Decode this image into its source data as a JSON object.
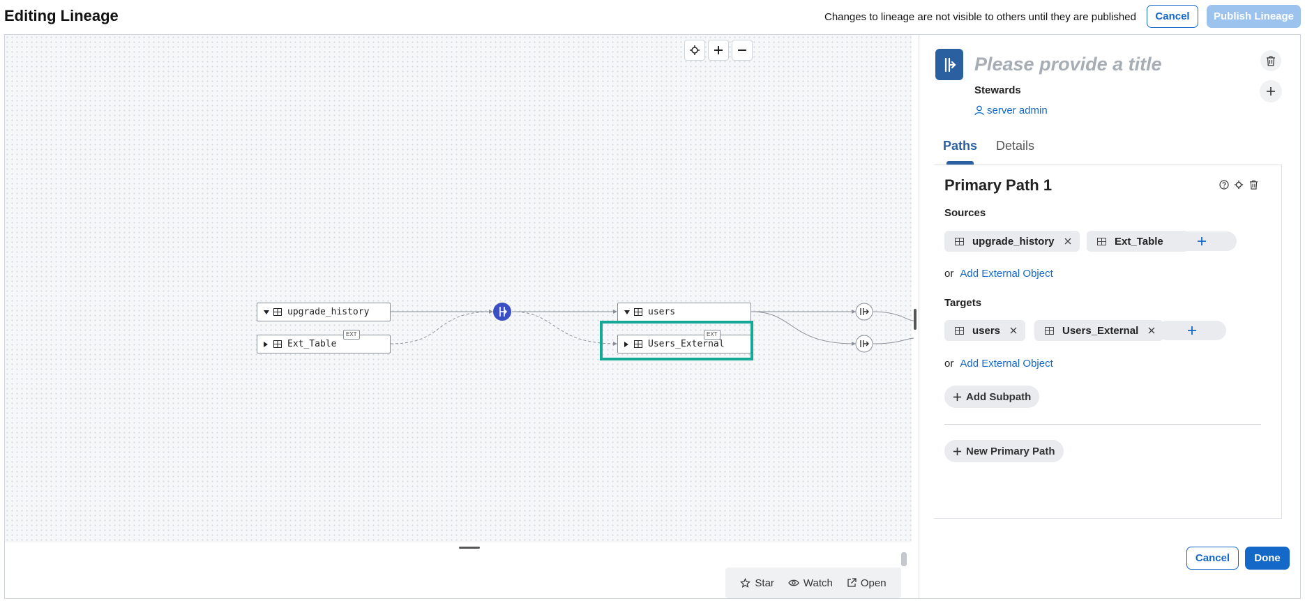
{
  "header": {
    "title": "Editing Lineage",
    "note": "Changes to lineage are not visible to others until they are published",
    "cancel_label": "Cancel",
    "publish_label": "Publish Lineage"
  },
  "canvas": {
    "sources": [
      {
        "name": "upgrade_history",
        "ext": ""
      },
      {
        "name": "Ext_Table",
        "ext": "EXT"
      }
    ],
    "targets": [
      {
        "name": "users",
        "ext": ""
      },
      {
        "name": "Users_External",
        "ext": "EXT"
      }
    ],
    "icons": {
      "recenter": "crosshair-icon",
      "zoom_in": "plus-icon",
      "zoom_out": "minus-icon",
      "process": "lineage-process-icon"
    }
  },
  "actions": {
    "star": "Star",
    "watch": "Watch",
    "open": "Open"
  },
  "panel": {
    "title_placeholder": "Please provide a title",
    "stewards_label": "Stewards",
    "steward": "server admin",
    "tabs": [
      "Paths",
      "Details"
    ],
    "path": {
      "title": "Primary Path 1",
      "sources_label": "Sources",
      "sources": [
        "upgrade_history",
        "Ext_Table"
      ],
      "targets_label": "Targets",
      "targets": [
        "users",
        "Users_External"
      ],
      "or_label": "or",
      "add_external": "Add External Object",
      "add_subpath": "Add Subpath"
    },
    "new_primary_path": "New Primary Path",
    "cancel_label": "Cancel",
    "done_label": "Done"
  },
  "colors": {
    "accent": "#1468c8",
    "accent_disabled": "#9cc2ee",
    "process_node": "#3b4fc4",
    "highlight": "#14a897",
    "tab_active": "#2a5fa0"
  }
}
